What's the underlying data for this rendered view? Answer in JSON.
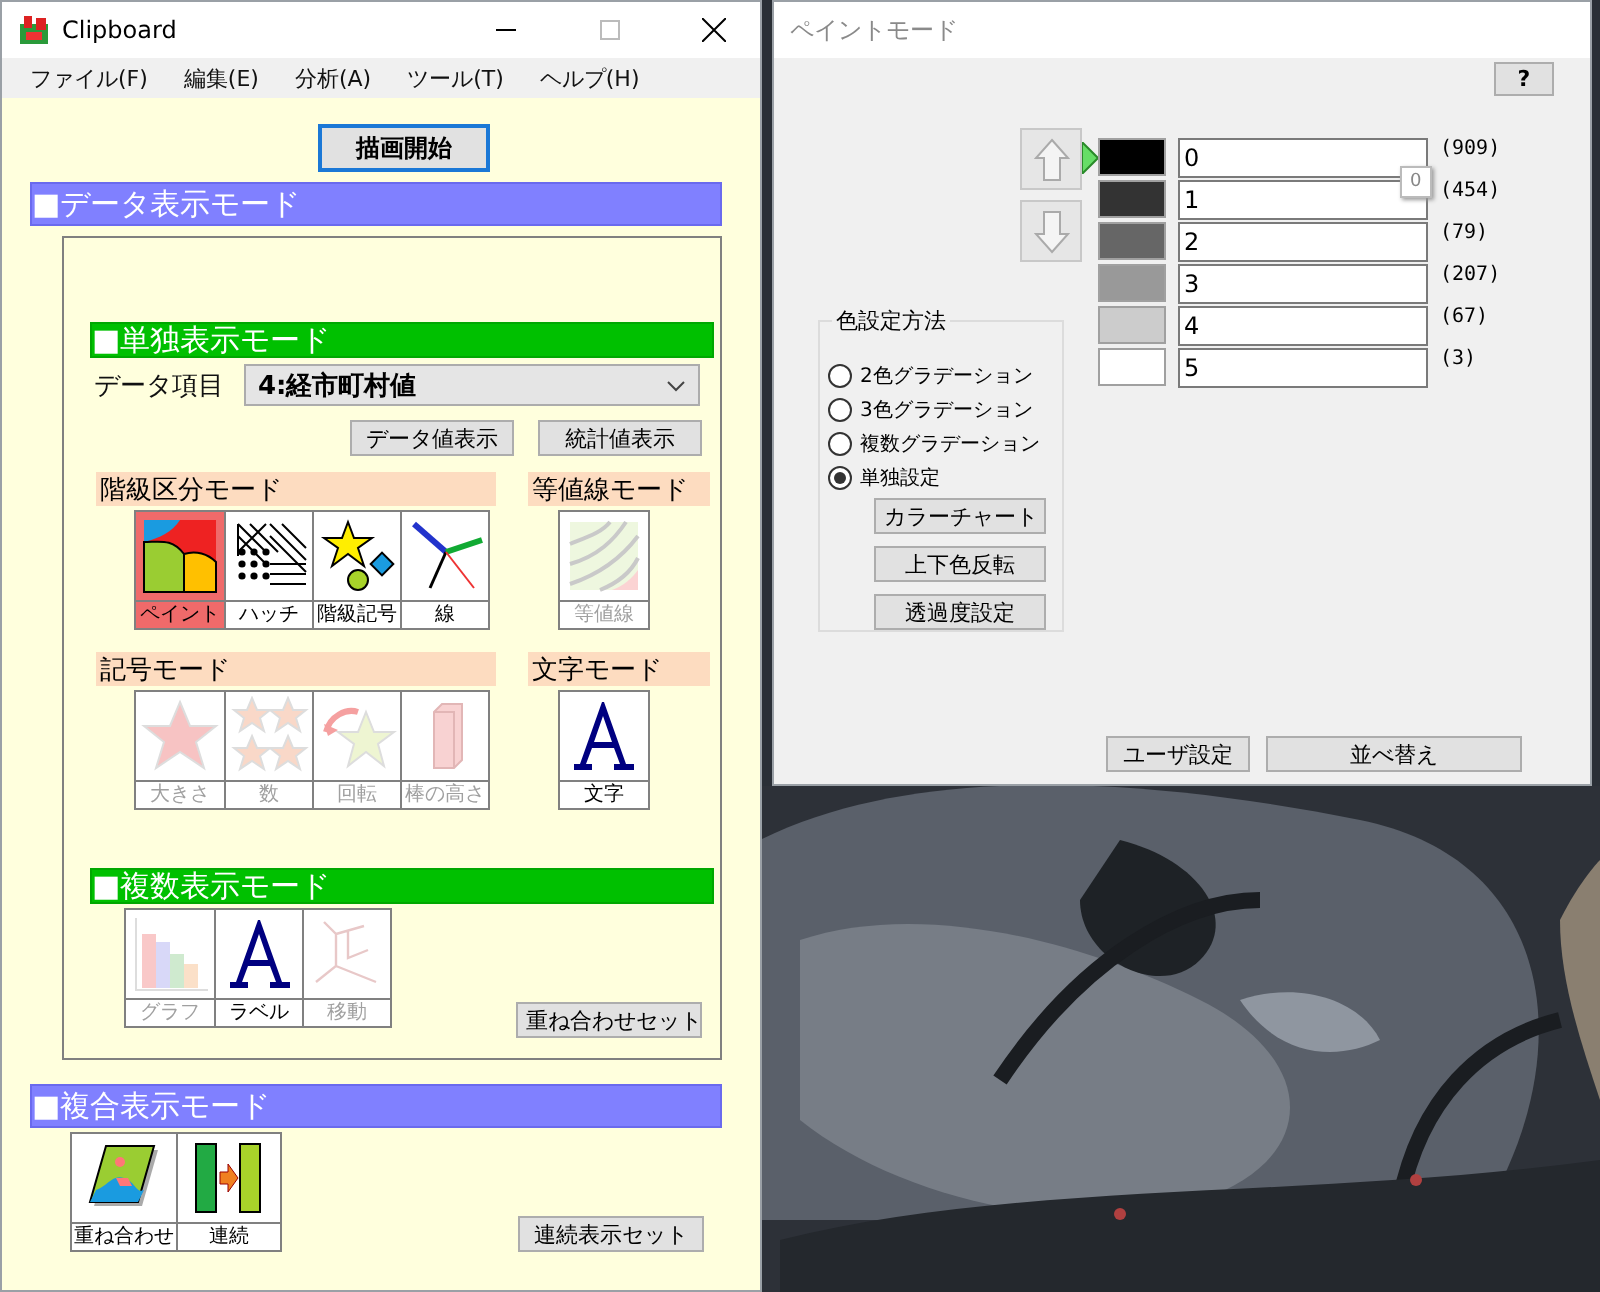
{
  "main_window": {
    "title": "Clipboard",
    "menu": [
      "ファイル(F)",
      "編集(E)",
      "分析(A)",
      "ツール(T)",
      "ヘルプ(H)"
    ],
    "start_button": "描画開始",
    "data_mode": {
      "title": "■データ表示モード",
      "single_mode": {
        "title": "■単独表示モード",
        "data_item_label": "データ項目",
        "data_item_value": "4:経市町村値",
        "buttons": [
          "データ値表示",
          "統計値表示"
        ],
        "groups": [
          {
            "title": "階級区分モード",
            "tools": [
              {
                "kind": "paint",
                "label": "ペイント",
                "selected": true,
                "disabled": false
              },
              {
                "kind": "hatch",
                "label": "ハッチ",
                "selected": false,
                "disabled": false
              },
              {
                "kind": "symbol",
                "label": "階級記号",
                "selected": false,
                "disabled": false
              },
              {
                "kind": "line",
                "label": "線",
                "selected": false,
                "disabled": false
              }
            ]
          },
          {
            "title": "等値線モード",
            "tools": [
              {
                "kind": "contour",
                "label": "等値線",
                "selected": false,
                "disabled": true
              }
            ]
          },
          {
            "title": "記号モード",
            "tools": [
              {
                "kind": "size",
                "label": "大きさ",
                "selected": false,
                "disabled": true
              },
              {
                "kind": "count",
                "label": "数",
                "selected": false,
                "disabled": true
              },
              {
                "kind": "rotate",
                "label": "回転",
                "selected": false,
                "disabled": true
              },
              {
                "kind": "bar",
                "label": "棒の高さ",
                "selected": false,
                "disabled": true
              }
            ]
          },
          {
            "title": "文字モード",
            "tools": [
              {
                "kind": "text",
                "label": "文字",
                "selected": false,
                "disabled": false
              }
            ]
          }
        ]
      },
      "multi_mode": {
        "title": "■複数表示モード",
        "tools": [
          {
            "kind": "graph",
            "label": "グラフ",
            "selected": false,
            "disabled": true
          },
          {
            "kind": "text",
            "label": "ラベル",
            "selected": false,
            "disabled": false
          },
          {
            "kind": "move",
            "label": "移動",
            "selected": false,
            "disabled": true
          }
        ],
        "button": "重ね合わせセット"
      }
    },
    "composite_mode": {
      "title": "■複合表示モード",
      "tools": [
        {
          "kind": "overlay",
          "label": "重ね合わせ",
          "selected": false,
          "disabled": false
        },
        {
          "kind": "sequence",
          "label": "連続",
          "selected": false,
          "disabled": false
        }
      ],
      "button": "連続表示セット"
    }
  },
  "paint_window": {
    "title": "ペイントモード",
    "help_button": "?",
    "rows": [
      {
        "value": "0",
        "count": "(909)",
        "color": "#000000",
        "selected": true
      },
      {
        "value": "1",
        "count": "(454)",
        "color": "#333333",
        "selected": false
      },
      {
        "value": "2",
        "count": "(79)",
        "color": "#666666",
        "selected": false
      },
      {
        "value": "3",
        "count": "(207)",
        "color": "#999999",
        "selected": false
      },
      {
        "value": "4",
        "count": "(67)",
        "color": "#cccccc",
        "selected": false
      },
      {
        "value": "5",
        "count": "(3)",
        "color": "#ffffff",
        "selected": false
      }
    ],
    "tooltip": "0",
    "color_method": {
      "title": "色設定方法",
      "options": [
        {
          "label": "2色グラデーション",
          "selected": false
        },
        {
          "label": "3色グラデーション",
          "selected": false
        },
        {
          "label": "複数グラデーション",
          "selected": false
        },
        {
          "label": "単独設定",
          "selected": true
        }
      ],
      "buttons": [
        "カラーチャート",
        "上下色反転",
        "透過度設定"
      ]
    },
    "bottom_buttons": [
      "ユーザ設定",
      "並べ替え"
    ]
  }
}
